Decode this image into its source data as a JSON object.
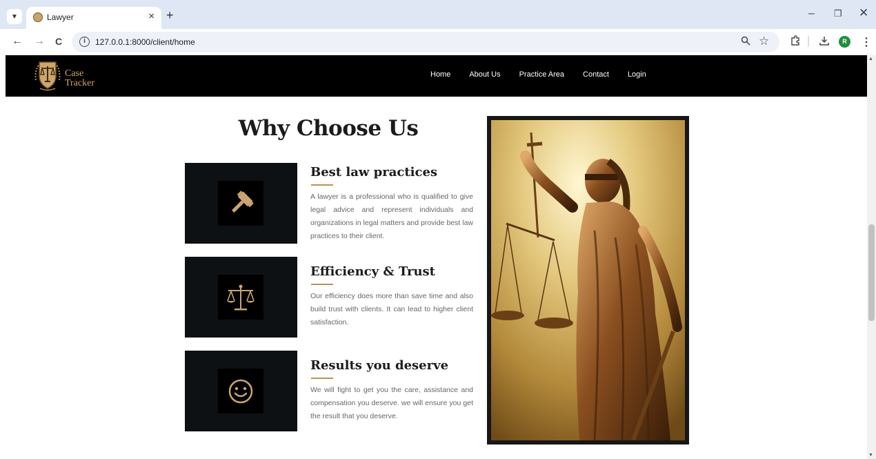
{
  "browser": {
    "tab_title": "Lawyer",
    "tab_close": "×",
    "new_tab": "+",
    "url": "127.0.0.1:8000/client/home",
    "back": "←",
    "forward": "→",
    "reload": "C",
    "profile_initial": "R",
    "icons": [
      "tab-search-icon",
      "zoom-icon",
      "bookmark-star-icon",
      "extensions-icon",
      "download-icon",
      "menu-dots-icon"
    ]
  },
  "site": {
    "logo_line1": "Case",
    "logo_line2": "Tracker",
    "nav": [
      "Home",
      "About Us",
      "Practice Area",
      "Contact",
      "Login"
    ]
  },
  "section": {
    "title": "Why Choose Us",
    "features": [
      {
        "title": "Best law practices",
        "icon": "gavel-icon",
        "desc": "A lawyer is a professional who is qualified to give legal advice and represent individuals and organizations in legal matters and provide best law practices to their client."
      },
      {
        "title": "Efficiency & Trust",
        "icon": "scales-icon",
        "desc": "Our efficiency does more than save time and also build trust with clients. It can lead to higher client satisfaction."
      },
      {
        "title": "Results you deserve",
        "icon": "smiley-icon",
        "desc": "We will fight to get you the care, assistance and compensation you deserve. we will ensure you get the result that you deserve."
      }
    ]
  },
  "colors": {
    "accent_gold": "#b5935a",
    "header_bg": "#000000",
    "feature_box_bg": "#0e1113",
    "profile_green": "#1e8e3e"
  }
}
